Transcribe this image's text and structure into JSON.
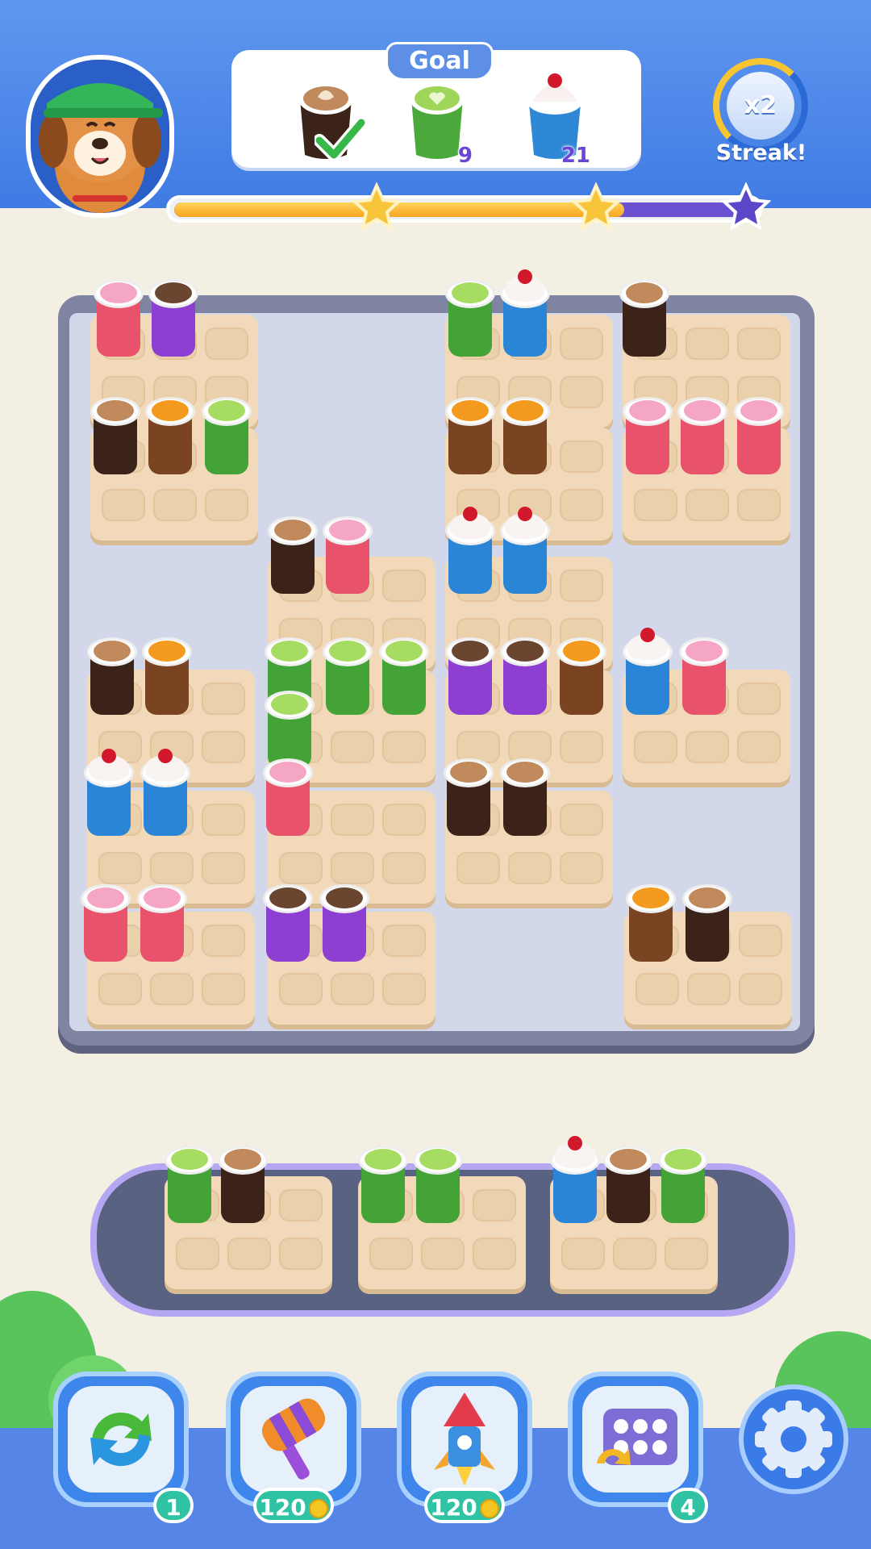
{
  "header": {
    "goal_label": "Goal",
    "goals": [
      {
        "item": "latte",
        "status": "complete",
        "count": ""
      },
      {
        "item": "matcha",
        "status": "pending",
        "count": "9"
      },
      {
        "item": "cherry-sundae",
        "status": "pending",
        "count": "21"
      }
    ],
    "streak": {
      "multiplier": "x2",
      "label": "Streak!"
    },
    "progress_fraction": 0.78
  },
  "boosters": [
    {
      "name": "shuffle",
      "badge": "1"
    },
    {
      "name": "hammer",
      "badge": "120"
    },
    {
      "name": "rocket",
      "badge": "120"
    },
    {
      "name": "swap-tray",
      "badge": "4"
    }
  ],
  "colors": {
    "header": "#4a86ea",
    "board": "#7f84a3",
    "tray": "#f1d9b9",
    "hold_frame": "#b6a7f3",
    "badge": "#2fc3a3"
  }
}
